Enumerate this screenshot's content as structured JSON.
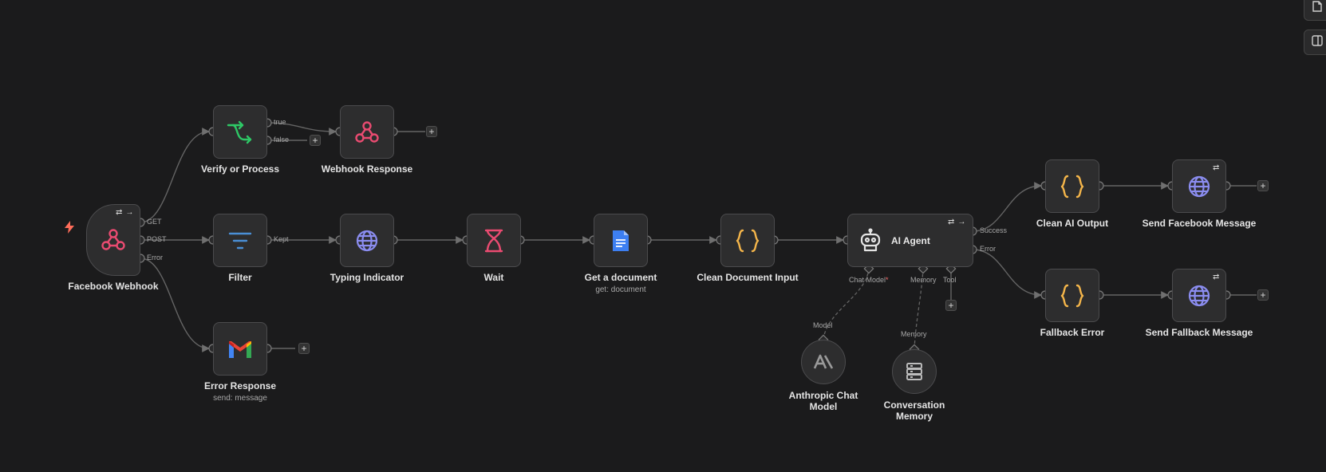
{
  "nodes": {
    "facebook_webhook": {
      "label": "Facebook Webhook"
    },
    "verify_or_process": {
      "label": "Verify or Process"
    },
    "webhook_response": {
      "label": "Webhook Response"
    },
    "filter": {
      "label": "Filter"
    },
    "typing_indicator": {
      "label": "Typing Indicator"
    },
    "wait": {
      "label": "Wait"
    },
    "get_document": {
      "label": "Get a document",
      "subtitle": "get: document"
    },
    "clean_document_input": {
      "label": "Clean Document Input"
    },
    "ai_agent": {
      "label": "AI Agent"
    },
    "error_response": {
      "label": "Error Response",
      "subtitle": "send: message"
    },
    "anthropic_chat_model": {
      "label_line1": "Anthropic Chat",
      "label_line2": "Model"
    },
    "conversation_memory": {
      "label_line1": "Conversation",
      "label_line2": "Memory"
    },
    "clean_ai_output": {
      "label": "Clean AI Output"
    },
    "send_facebook_message": {
      "label": "Send Facebook Message"
    },
    "fallback_error": {
      "label": "Fallback Error"
    },
    "send_fallback_message": {
      "label": "Send Fallback Message"
    }
  },
  "ports": {
    "webhook_get": "GET",
    "webhook_post": "POST",
    "webhook_error": "Error",
    "if_true": "true",
    "if_false": "false",
    "filter_kept": "Kept",
    "agent_success": "Success",
    "agent_error": "Error",
    "agent_chat_model": "Chat Model",
    "agent_memory": "Memory",
    "agent_tool": "Tool",
    "model_out": "Model",
    "memory_out": "Memory"
  },
  "controls": {
    "add_symbol": "+"
  },
  "icons": {
    "webhook": "webhook-icon",
    "if": "if-branch-icon",
    "filter": "filter-icon",
    "http": "globe-icon",
    "wait": "hourglass-icon",
    "google_docs": "google-docs-icon",
    "code": "curly-braces-icon",
    "agent": "robot-icon",
    "gmail": "gmail-icon",
    "anthropic": "anthropic-icon",
    "memory": "database-icon"
  },
  "colors": {
    "background": "#1b1b1c",
    "node": "#2d2d2e",
    "webhook": "#ea4b71",
    "if": "#2ec866",
    "filter": "#4a8fd6",
    "http": "#8b8df0",
    "code": "#f4b54a",
    "trigger": "#ff6d5a"
  }
}
